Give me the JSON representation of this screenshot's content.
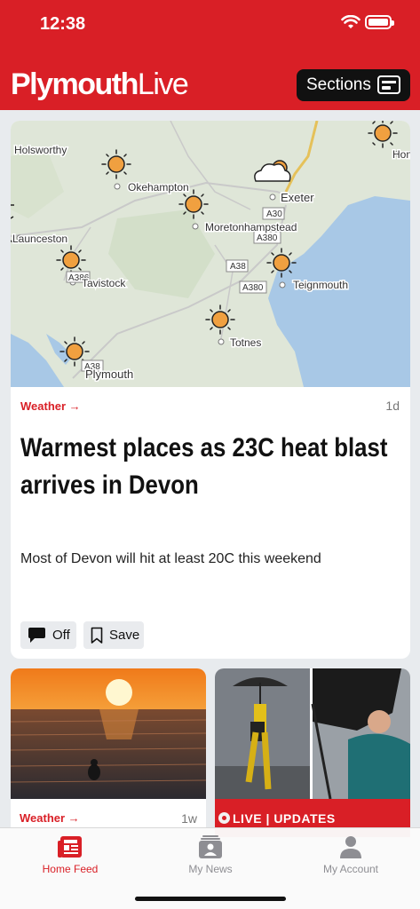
{
  "status_bar": {
    "time": "12:38"
  },
  "header": {
    "logo_bold": "Plymouth",
    "logo_light": "Live",
    "sections_label": "Sections",
    "bg_color": "#d91f26"
  },
  "top_story": {
    "category": "Weather",
    "age": "1d",
    "headline": "Warmest places as 23C heat blast arrives in Devon",
    "summary": "Most of Devon will hit at least 20C this weekend",
    "comments_label": "Off",
    "save_label": "Save",
    "map_labels": {
      "holsworthy": "Holsworthy",
      "okehampton": "Okehampton",
      "exeter": "Exeter",
      "launceston": "Launceston",
      "moretonhampstead": "Moretonhampstead",
      "tavistock": "Tavistock",
      "teignmouth": "Teignmouth",
      "totnes": "Totnes",
      "plymouth": "Plymouth",
      "hon": "Hon",
      "a30": "A30",
      "a380_1": "A380",
      "a38_1": "A38",
      "a380_2": "A380",
      "a386": "A386",
      "a38_2": "A38"
    }
  },
  "cards": [
    {
      "category": "Weather",
      "age": "1w"
    },
    {
      "live_label": "LIVE | UPDATES"
    }
  ],
  "tabs": [
    {
      "label": "Home Feed",
      "icon": "home-feed-icon",
      "active": true
    },
    {
      "label": "My News",
      "icon": "my-news-icon",
      "active": false
    },
    {
      "label": "My Account",
      "icon": "my-account-icon",
      "active": false
    }
  ],
  "colors": {
    "accent": "#d91f26",
    "map_land": "#dfe6d8",
    "map_sea": "#a8c8e6",
    "sun": "#f0a040"
  }
}
